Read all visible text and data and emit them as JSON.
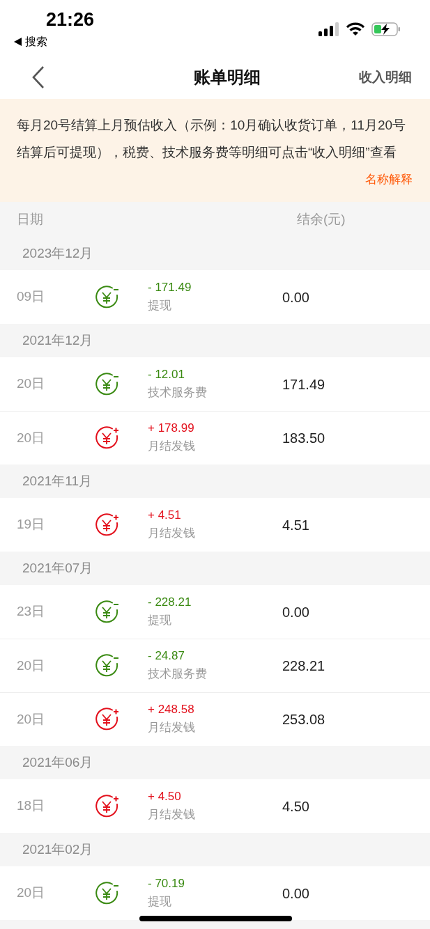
{
  "status_bar": {
    "time": "21:26",
    "back_app": "搜索"
  },
  "nav": {
    "title": "账单明细",
    "action": "收入明细"
  },
  "notice": {
    "text": "每月20号结算上月预估收入（示例：10月确认收货订单，11月20号结算后可提现），税费、技术服务费等明细可点击“收入明细”查看",
    "link": "名称解释"
  },
  "columns": [
    "日期",
    "结余(元)"
  ],
  "groups": [
    {
      "month": "2023年12月",
      "entries": [
        {
          "day": "09日",
          "kind": "expense",
          "amount": "- 171.49",
          "label": "提现",
          "balance": "0.00"
        }
      ]
    },
    {
      "month": "2021年12月",
      "entries": [
        {
          "day": "20日",
          "kind": "expense",
          "amount": "- 12.01",
          "label": "技术服务费",
          "balance": "171.49"
        },
        {
          "day": "20日",
          "kind": "income",
          "amount": "+ 178.99",
          "label": "月结发钱",
          "balance": "183.50"
        }
      ]
    },
    {
      "month": "2021年11月",
      "entries": [
        {
          "day": "19日",
          "kind": "income",
          "amount": "+ 4.51",
          "label": "月结发钱",
          "balance": "4.51"
        }
      ]
    },
    {
      "month": "2021年07月",
      "entries": [
        {
          "day": "23日",
          "kind": "expense",
          "amount": "- 228.21",
          "label": "提现",
          "balance": "0.00"
        },
        {
          "day": "20日",
          "kind": "expense",
          "amount": "- 24.87",
          "label": "技术服务费",
          "balance": "228.21"
        },
        {
          "day": "20日",
          "kind": "income",
          "amount": "+ 248.58",
          "label": "月结发钱",
          "balance": "253.08"
        }
      ]
    },
    {
      "month": "2021年06月",
      "entries": [
        {
          "day": "18日",
          "kind": "income",
          "amount": "+ 4.50",
          "label": "月结发钱",
          "balance": "4.50"
        }
      ]
    },
    {
      "month": "2021年02月",
      "entries": [
        {
          "day": "20日",
          "kind": "expense",
          "amount": "- 70.19",
          "label": "提现",
          "balance": "0.00"
        }
      ]
    }
  ]
}
